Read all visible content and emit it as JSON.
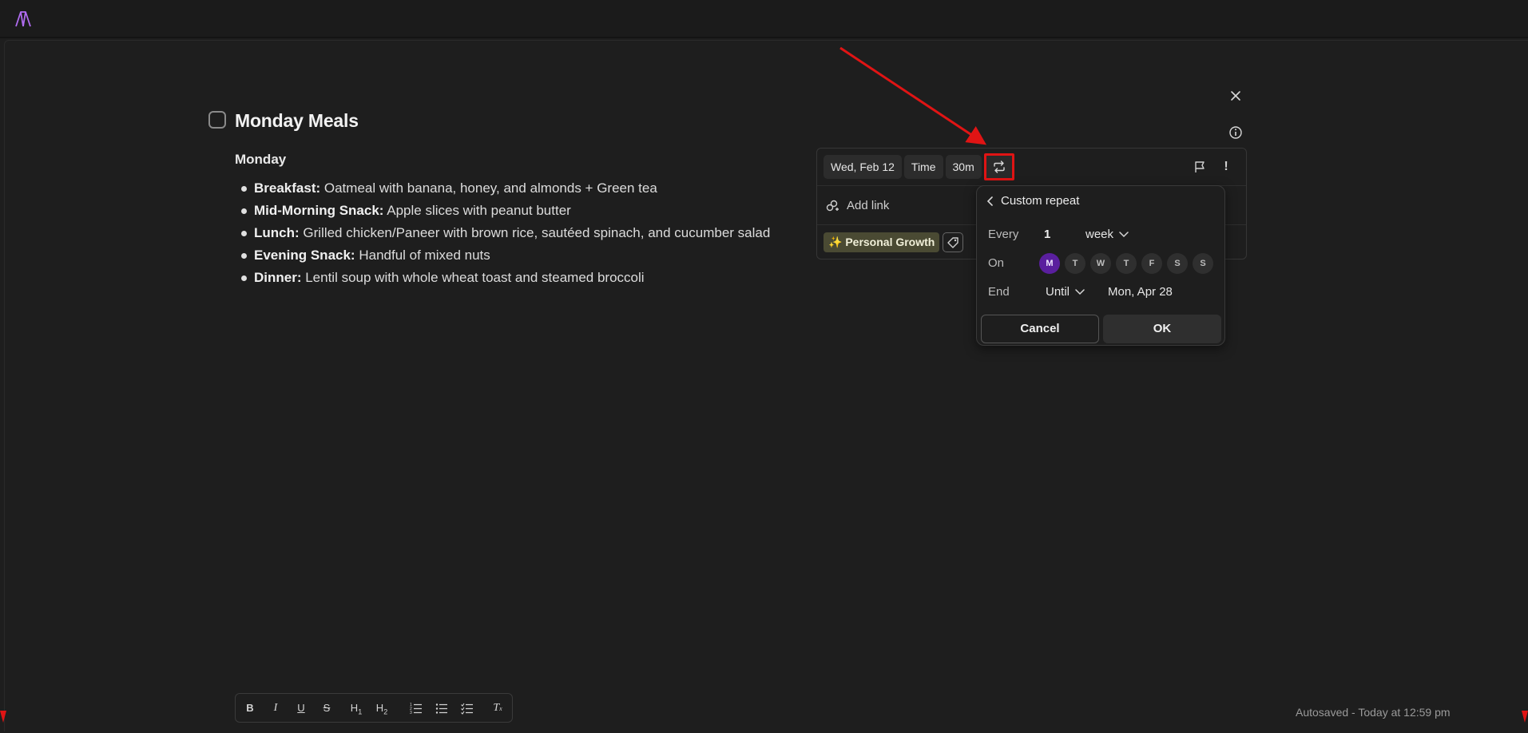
{
  "task": {
    "title": "Monday Meals",
    "section_heading": "Monday",
    "items": [
      {
        "label": "Breakfast:",
        "text": " Oatmeal with banana, honey, and almonds + Green tea"
      },
      {
        "label": "Mid-Morning Snack:",
        "text": " Apple slices with peanut butter"
      },
      {
        "label": "Lunch:",
        "text": " Grilled chicken/Paneer with brown rice, sautéed spinach, and cucumber salad"
      },
      {
        "label": "Evening Snack:",
        "text": " Handful of mixed nuts"
      },
      {
        "label": "Dinner:",
        "text": " Lentil soup with whole wheat toast and steamed broccoli"
      }
    ]
  },
  "properties": {
    "date": "Wed, Feb 12",
    "time": "Time",
    "duration": "30m",
    "add_link": "Add link",
    "tag": "✨ Personal Growth",
    "priority_glyph": "!"
  },
  "repeat": {
    "title": "Custom repeat",
    "every_label": "Every",
    "every_value": "1",
    "unit": "week",
    "on_label": "On",
    "days": [
      {
        "letter": "M",
        "selected": true
      },
      {
        "letter": "T",
        "selected": false
      },
      {
        "letter": "W",
        "selected": false
      },
      {
        "letter": "T",
        "selected": false
      },
      {
        "letter": "F",
        "selected": false
      },
      {
        "letter": "S",
        "selected": false
      },
      {
        "letter": "S",
        "selected": false
      }
    ],
    "end_label": "End",
    "end_mode": "Until",
    "end_date": "Mon, Apr 28",
    "cancel": "Cancel",
    "ok": "OK"
  },
  "toolbar": {
    "bold": "B",
    "italic": "I",
    "underline": "U",
    "strike": "S",
    "h1": "H",
    "h1_sub": "1",
    "h2": "H",
    "h2_sub": "2",
    "clear": "T"
  },
  "footer": {
    "autosaved": "Autosaved - Today at 12:59 pm"
  },
  "colors": {
    "accent": "#5a1f9e",
    "logo": "#b06cf0",
    "annotation": "#e01414",
    "tag_bg": "#4a4a33"
  },
  "icons": [
    "app-logo-icon",
    "close-icon",
    "info-icon",
    "repeat-icon",
    "flag-icon",
    "link-icon",
    "tag-icon",
    "chevron-left-icon",
    "chevron-down-icon",
    "ordered-list-icon",
    "bullet-list-icon",
    "checklist-icon"
  ]
}
